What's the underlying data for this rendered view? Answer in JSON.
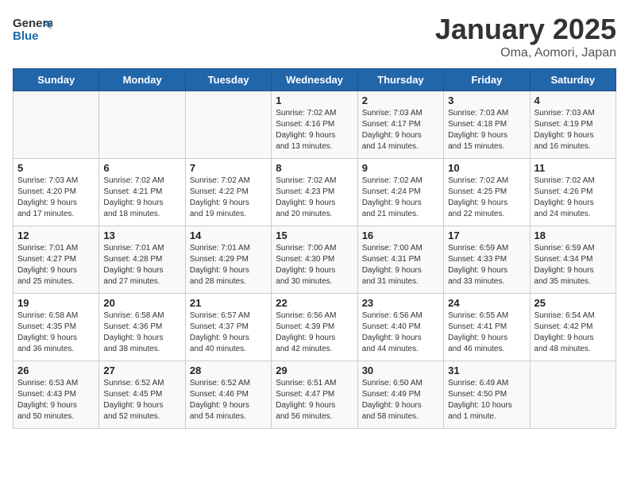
{
  "header": {
    "logo_general": "General",
    "logo_blue": "Blue",
    "title": "January 2025",
    "subtitle": "Oma, Aomori, Japan"
  },
  "weekdays": [
    "Sunday",
    "Monday",
    "Tuesday",
    "Wednesday",
    "Thursday",
    "Friday",
    "Saturday"
  ],
  "weeks": [
    [
      {
        "day": "",
        "info": ""
      },
      {
        "day": "",
        "info": ""
      },
      {
        "day": "",
        "info": ""
      },
      {
        "day": "1",
        "info": "Sunrise: 7:02 AM\nSunset: 4:16 PM\nDaylight: 9 hours\nand 13 minutes."
      },
      {
        "day": "2",
        "info": "Sunrise: 7:03 AM\nSunset: 4:17 PM\nDaylight: 9 hours\nand 14 minutes."
      },
      {
        "day": "3",
        "info": "Sunrise: 7:03 AM\nSunset: 4:18 PM\nDaylight: 9 hours\nand 15 minutes."
      },
      {
        "day": "4",
        "info": "Sunrise: 7:03 AM\nSunset: 4:19 PM\nDaylight: 9 hours\nand 16 minutes."
      }
    ],
    [
      {
        "day": "5",
        "info": "Sunrise: 7:03 AM\nSunset: 4:20 PM\nDaylight: 9 hours\nand 17 minutes."
      },
      {
        "day": "6",
        "info": "Sunrise: 7:02 AM\nSunset: 4:21 PM\nDaylight: 9 hours\nand 18 minutes."
      },
      {
        "day": "7",
        "info": "Sunrise: 7:02 AM\nSunset: 4:22 PM\nDaylight: 9 hours\nand 19 minutes."
      },
      {
        "day": "8",
        "info": "Sunrise: 7:02 AM\nSunset: 4:23 PM\nDaylight: 9 hours\nand 20 minutes."
      },
      {
        "day": "9",
        "info": "Sunrise: 7:02 AM\nSunset: 4:24 PM\nDaylight: 9 hours\nand 21 minutes."
      },
      {
        "day": "10",
        "info": "Sunrise: 7:02 AM\nSunset: 4:25 PM\nDaylight: 9 hours\nand 22 minutes."
      },
      {
        "day": "11",
        "info": "Sunrise: 7:02 AM\nSunset: 4:26 PM\nDaylight: 9 hours\nand 24 minutes."
      }
    ],
    [
      {
        "day": "12",
        "info": "Sunrise: 7:01 AM\nSunset: 4:27 PM\nDaylight: 9 hours\nand 25 minutes."
      },
      {
        "day": "13",
        "info": "Sunrise: 7:01 AM\nSunset: 4:28 PM\nDaylight: 9 hours\nand 27 minutes."
      },
      {
        "day": "14",
        "info": "Sunrise: 7:01 AM\nSunset: 4:29 PM\nDaylight: 9 hours\nand 28 minutes."
      },
      {
        "day": "15",
        "info": "Sunrise: 7:00 AM\nSunset: 4:30 PM\nDaylight: 9 hours\nand 30 minutes."
      },
      {
        "day": "16",
        "info": "Sunrise: 7:00 AM\nSunset: 4:31 PM\nDaylight: 9 hours\nand 31 minutes."
      },
      {
        "day": "17",
        "info": "Sunrise: 6:59 AM\nSunset: 4:33 PM\nDaylight: 9 hours\nand 33 minutes."
      },
      {
        "day": "18",
        "info": "Sunrise: 6:59 AM\nSunset: 4:34 PM\nDaylight: 9 hours\nand 35 minutes."
      }
    ],
    [
      {
        "day": "19",
        "info": "Sunrise: 6:58 AM\nSunset: 4:35 PM\nDaylight: 9 hours\nand 36 minutes."
      },
      {
        "day": "20",
        "info": "Sunrise: 6:58 AM\nSunset: 4:36 PM\nDaylight: 9 hours\nand 38 minutes."
      },
      {
        "day": "21",
        "info": "Sunrise: 6:57 AM\nSunset: 4:37 PM\nDaylight: 9 hours\nand 40 minutes."
      },
      {
        "day": "22",
        "info": "Sunrise: 6:56 AM\nSunset: 4:39 PM\nDaylight: 9 hours\nand 42 minutes."
      },
      {
        "day": "23",
        "info": "Sunrise: 6:56 AM\nSunset: 4:40 PM\nDaylight: 9 hours\nand 44 minutes."
      },
      {
        "day": "24",
        "info": "Sunrise: 6:55 AM\nSunset: 4:41 PM\nDaylight: 9 hours\nand 46 minutes."
      },
      {
        "day": "25",
        "info": "Sunrise: 6:54 AM\nSunset: 4:42 PM\nDaylight: 9 hours\nand 48 minutes."
      }
    ],
    [
      {
        "day": "26",
        "info": "Sunrise: 6:53 AM\nSunset: 4:43 PM\nDaylight: 9 hours\nand 50 minutes."
      },
      {
        "day": "27",
        "info": "Sunrise: 6:52 AM\nSunset: 4:45 PM\nDaylight: 9 hours\nand 52 minutes."
      },
      {
        "day": "28",
        "info": "Sunrise: 6:52 AM\nSunset: 4:46 PM\nDaylight: 9 hours\nand 54 minutes."
      },
      {
        "day": "29",
        "info": "Sunrise: 6:51 AM\nSunset: 4:47 PM\nDaylight: 9 hours\nand 56 minutes."
      },
      {
        "day": "30",
        "info": "Sunrise: 6:50 AM\nSunset: 4:49 PM\nDaylight: 9 hours\nand 58 minutes."
      },
      {
        "day": "31",
        "info": "Sunrise: 6:49 AM\nSunset: 4:50 PM\nDaylight: 10 hours\nand 1 minute."
      },
      {
        "day": "",
        "info": ""
      }
    ]
  ]
}
